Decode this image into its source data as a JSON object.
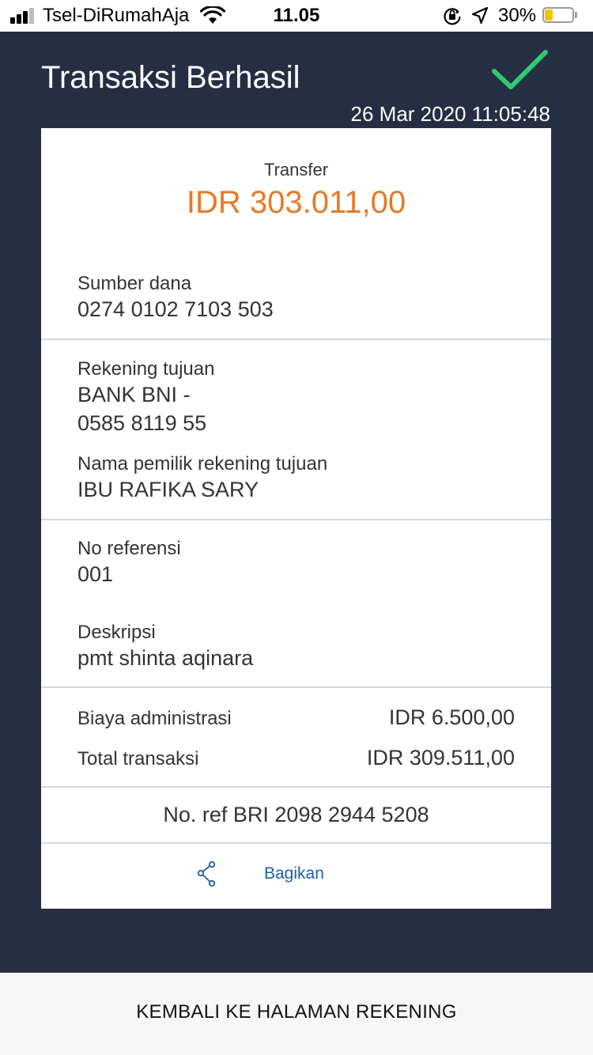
{
  "status_bar": {
    "carrier": "Tsel-DiRumahAja",
    "time": "11.05",
    "battery_percent": "30%",
    "battery_level": 0.3,
    "icons": [
      "signal-icon",
      "wifi-icon",
      "rotation-lock-icon",
      "location-icon",
      "battery-icon"
    ]
  },
  "header": {
    "title": "Transaksi Berhasil",
    "datetime": "26 Mar 2020 11:05:48",
    "success_icon": "check-icon",
    "success_color": "#2ecc71",
    "background_color": "#262e44"
  },
  "receipt": {
    "type_label": "Transfer",
    "amount": "IDR 303.011,00",
    "amount_color": "#e67a27",
    "source_label": "Sumber dana",
    "source_value": "0274 0102 7103 503",
    "dest_label": "Rekening tujuan",
    "dest_bank": "BANK BNI -",
    "dest_account": "0585 8119 55",
    "owner_label": "Nama pemilik rekening tujuan",
    "owner_value": "IBU RAFIKA  SARY",
    "ref_label": "No referensi",
    "ref_value": "001",
    "desc_label": "Deskripsi",
    "desc_value": "pmt shinta aqinara",
    "fee_label": "Biaya administrasi",
    "fee_value": "IDR 6.500,00",
    "total_label": "Total transaksi",
    "total_value": "IDR 309.511,00",
    "bri_ref": "No. ref BRI 2098 2944 5208",
    "share_label": "Bagikan",
    "share_icon": "share-icon"
  },
  "footer": {
    "back_button": "KEMBALI KE HALAMAN REKENING"
  }
}
